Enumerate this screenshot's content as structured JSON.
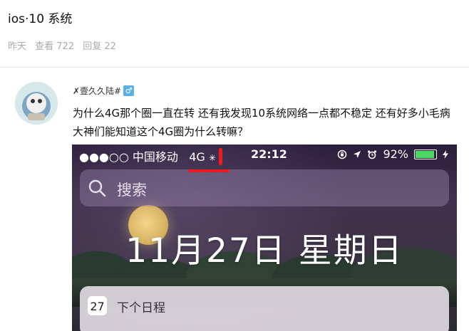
{
  "post": {
    "title": "ios·10 系统",
    "meta": {
      "time": "昨天",
      "views_label": "查看 722",
      "replies_label": "回复 22"
    }
  },
  "author": {
    "name": "✗壹久久陆#",
    "gender_symbol": "♂"
  },
  "content": {
    "text": "为什么4G那个圈一直在转 还有我发现10系统网络一点都不稳定 还有好多小毛病 大神们能知道这个4G圈为什么转嘛？"
  },
  "screenshot": {
    "status": {
      "signal": "●●●○○",
      "carrier": "中国移动",
      "network": "4G",
      "spinner": "✳",
      "time": "22:12",
      "battery_percent": "92%",
      "battery_level": 0.92
    },
    "search_placeholder": "搜索",
    "date": "11月27日 星期日",
    "widget": {
      "calendar_day": "27",
      "title": "下个日程"
    }
  },
  "colors": {
    "accent_red": "#ef1c1c",
    "battery_green": "#4cd964",
    "gender_blue": "#5ab0e6"
  }
}
